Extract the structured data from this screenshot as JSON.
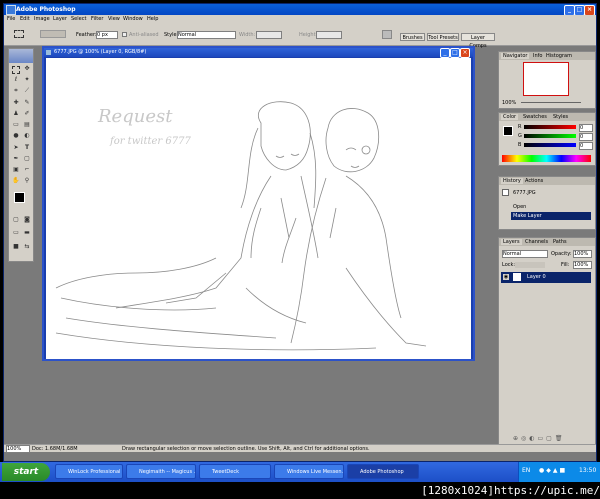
{
  "window": {
    "title": "Adobe Photoshop"
  },
  "menu": [
    "File",
    "Edit",
    "Image",
    "Layer",
    "Select",
    "Filter",
    "View",
    "Window",
    "Help"
  ],
  "options": {
    "feather_label": "Feather:",
    "feather_value": "0 px",
    "antialiased_label": "Anti-aliased",
    "style_label": "Style:",
    "style_value": "Normal",
    "width_label": "Width:",
    "height_label": "Height:",
    "dock_tabs": [
      "Brushes",
      "Tool Presets",
      "Layer Comps"
    ]
  },
  "document": {
    "title": "6777.JPG @ 100% (Layer 0, RGB/8#)",
    "sketch_text_1": "Request",
    "sketch_text_2": "for twitter 6777"
  },
  "navigator": {
    "tabs": [
      "Navigator",
      "Info",
      "Histogram"
    ],
    "zoom": "100%"
  },
  "color_panel": {
    "tabs": [
      "Color",
      "Swatches",
      "Styles"
    ],
    "channels": [
      {
        "label": "R",
        "value": "0"
      },
      {
        "label": "G",
        "value": "0"
      },
      {
        "label": "B",
        "value": "0"
      }
    ]
  },
  "history": {
    "tabs": [
      "History",
      "Actions"
    ],
    "snapshot": "6777.JPG",
    "items": [
      "Open",
      "Make Layer"
    ]
  },
  "layers": {
    "tabs": [
      "Layers",
      "Channels",
      "Paths"
    ],
    "blend": "Normal",
    "opacity_label": "Opacity:",
    "opacity": "100%",
    "lock_label": "Lock:",
    "fill_label": "Fill:",
    "fill": "100%",
    "layer_name": "Layer 0"
  },
  "status": {
    "zoom": "100%",
    "doc": "Doc: 1.68M/1.68M",
    "hint": "Draw rectangular selection or move selection outline. Use Shift, Alt, and Ctrl for additional options."
  },
  "taskbar": {
    "start": "start",
    "items": [
      "WinLock Professional",
      "Negimaith -- Magicus ...",
      "TweetDeck",
      "Windows Live Messen...",
      "Adobe Photoshop"
    ],
    "lang": "EN",
    "clock": "13:50"
  },
  "watermark": "[1280x1024]https://upic.me/",
  "colors": {
    "title_blue": "#0a5fd8",
    "taskbar_blue": "#3169e0",
    "start_green": "#3fa53c",
    "workspace": "#7a7a7a"
  }
}
